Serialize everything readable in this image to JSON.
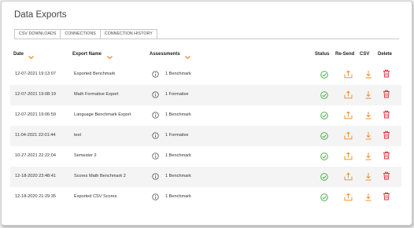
{
  "page": {
    "title": "Data Exports"
  },
  "tabs": [
    {
      "label": "CSV DOWNLOADS",
      "active": true
    },
    {
      "label": "CONNECTIONS",
      "active": false
    },
    {
      "label": "CONNECTION HISTORY",
      "active": false
    }
  ],
  "table": {
    "headers": {
      "date": "Date",
      "export_name": "Export Name",
      "assessments": "Assessments",
      "status": "Status",
      "resend": "Re-Send",
      "csv": "CSV",
      "delete": "Delete"
    },
    "rows": [
      {
        "date": "12-07-2021 19:13:07",
        "name": "Exported Benchmark",
        "assessments": "1 Benchmark"
      },
      {
        "date": "12-07-2021 19:08:19",
        "name": "Math Formative Export",
        "assessments": "1 Formative"
      },
      {
        "date": "12-07-2021 19:06:59",
        "name": "Language Benchmark Export",
        "assessments": "1 Benchmark"
      },
      {
        "date": "11-04-2021 22:01:44",
        "name": "test",
        "assessments": "1 Formative"
      },
      {
        "date": "10-27-2021 22:22:04",
        "name": "Semester 2",
        "assessments": "1 Benchmark"
      },
      {
        "date": "12-18-2020 23:48:41",
        "name": "Scores Math Benchmark 2",
        "assessments": "1 Benchmark"
      },
      {
        "date": "12-18-2020 21:29:35",
        "name": "Exported CSV Scores",
        "assessments": "1 Benchmark"
      }
    ]
  },
  "colors": {
    "accent": "#f0861e",
    "success": "#3aa83a",
    "danger": "#d6333a"
  },
  "icons": {
    "sort": "chevron-down-icon",
    "info": "info-icon",
    "status": "check-circle-icon",
    "resend": "send-tray-icon",
    "csv": "download-icon",
    "delete": "trash-icon"
  }
}
